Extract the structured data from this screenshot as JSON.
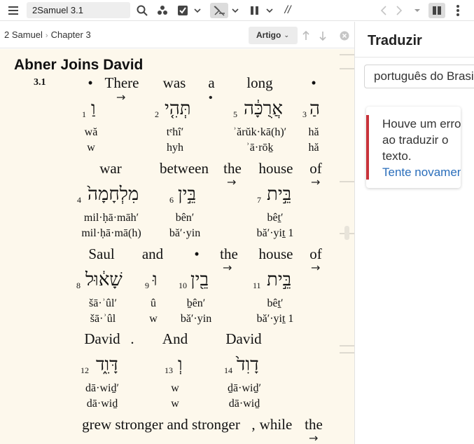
{
  "toolbar": {
    "reference": "2Samuel 3.1",
    "parallel_icon_text": "//"
  },
  "breadcrumb": {
    "book": "2 Samuel",
    "chapter": "Chapter 3"
  },
  "view_selector": {
    "label": "Artigo"
  },
  "reading": {
    "section_title": "Abner Joins David",
    "verse_number": "3.1",
    "lines": [
      {
        "english": [
          "•",
          "There",
          "was",
          "a",
          "long",
          "•"
        ],
        "hebrew": [
          {
            "n": "1",
            "heb": "וַ",
            "tr": "wă",
            "tr2": "w"
          },
          {
            "n": "2",
            "heb": "תְּהִ֤י",
            "tr": "tᵉhî′",
            "tr2": "hyh"
          },
          {
            "n": "5",
            "heb": "אֲרֻכָּ֔ה",
            "tr": "ʾărŭk·kā(h)′",
            "tr2": "ʾā·rōḵ"
          },
          {
            "n": "3",
            "heb": "הַ",
            "tr": "hă",
            "tr2": "hă"
          }
        ]
      },
      {
        "english": [
          "war",
          "between",
          "the",
          "house",
          "of"
        ],
        "hebrew": [
          {
            "n": "4",
            "heb": "מִלְחָמָה֙",
            "tr": "mil·ḥā·māh′",
            "tr2": "mil·ḥā·mā(h)"
          },
          {
            "n": "6",
            "heb": "בֵּ֣ין",
            "tr": "bên′",
            "tr2": "bă′·yin"
          },
          {
            "n": "7",
            "heb": "בֵּ֣ית",
            "tr": "bêṯ′",
            "tr2": "bă′·yiṯ 1"
          }
        ]
      },
      {
        "english": [
          "Saul",
          "and",
          "•",
          "the",
          "house",
          "of"
        ],
        "hebrew": [
          {
            "n": "8",
            "heb": "שָׁא֔וּל",
            "tr": "šā·ʾûl′",
            "tr2": "šā·ʾûl"
          },
          {
            "n": "9",
            "heb": "וּ",
            "tr": "û",
            "tr2": "w"
          },
          {
            "n": "10",
            "heb": "בֵ֖ין",
            "tr": "ḇên′",
            "tr2": "bă′·yin"
          },
          {
            "n": "11",
            "heb": "בֵּ֣ית",
            "tr": "bêṯ′",
            "tr2": "bă′·yiṯ 1"
          }
        ]
      },
      {
        "english": [
          "David",
          ".",
          "And",
          "David"
        ],
        "hebrew": [
          {
            "n": "12",
            "heb": "דָּוִ֑ד",
            "tr": "dā·wiḏ′",
            "tr2": "dā·wiḏ"
          },
          {
            "n": "13",
            "heb": "וְ",
            "tr": "w",
            "tr2": "w"
          },
          {
            "n": "14",
            "heb": "דָוִד֙",
            "tr": "ḏā·wiḏ′",
            "tr2": "dā·wiḏ"
          }
        ]
      },
      {
        "english": [
          "grew stronger and stronger",
          ",",
          "while",
          "the"
        ],
        "hebrew": []
      }
    ]
  },
  "translate_panel": {
    "title": "Traduzir",
    "language": "português do Brasil",
    "error_line1": "Houve um erro",
    "error_line2": "ao traduzir o",
    "error_line3": "texto.",
    "retry": "Tente novamente"
  }
}
